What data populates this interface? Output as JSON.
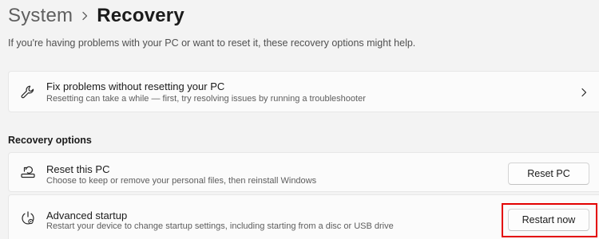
{
  "breadcrumb": {
    "parent": "System",
    "current": "Recovery"
  },
  "description": "If you're having problems with your PC or want to reset it, these recovery options might help.",
  "fix_card": {
    "title": "Fix problems without resetting your PC",
    "subtitle": "Resetting can take a while — first, try resolving issues by running a troubleshooter",
    "icon": "wrench-icon"
  },
  "section": {
    "title": "Recovery options"
  },
  "options": {
    "reset": {
      "title": "Reset this PC",
      "subtitle": "Choose to keep or remove your personal files, then reinstall Windows",
      "button": "Reset PC",
      "icon": "reset-pc-icon"
    },
    "advanced": {
      "title": "Advanced startup",
      "subtitle": "Restart your device to change startup settings, including starting from a disc or USB drive",
      "button": "Restart now",
      "icon": "advanced-startup-icon"
    }
  },
  "colors": {
    "background": "#f3f3f3",
    "card": "#fbfbfb",
    "highlight": "#e30000"
  }
}
